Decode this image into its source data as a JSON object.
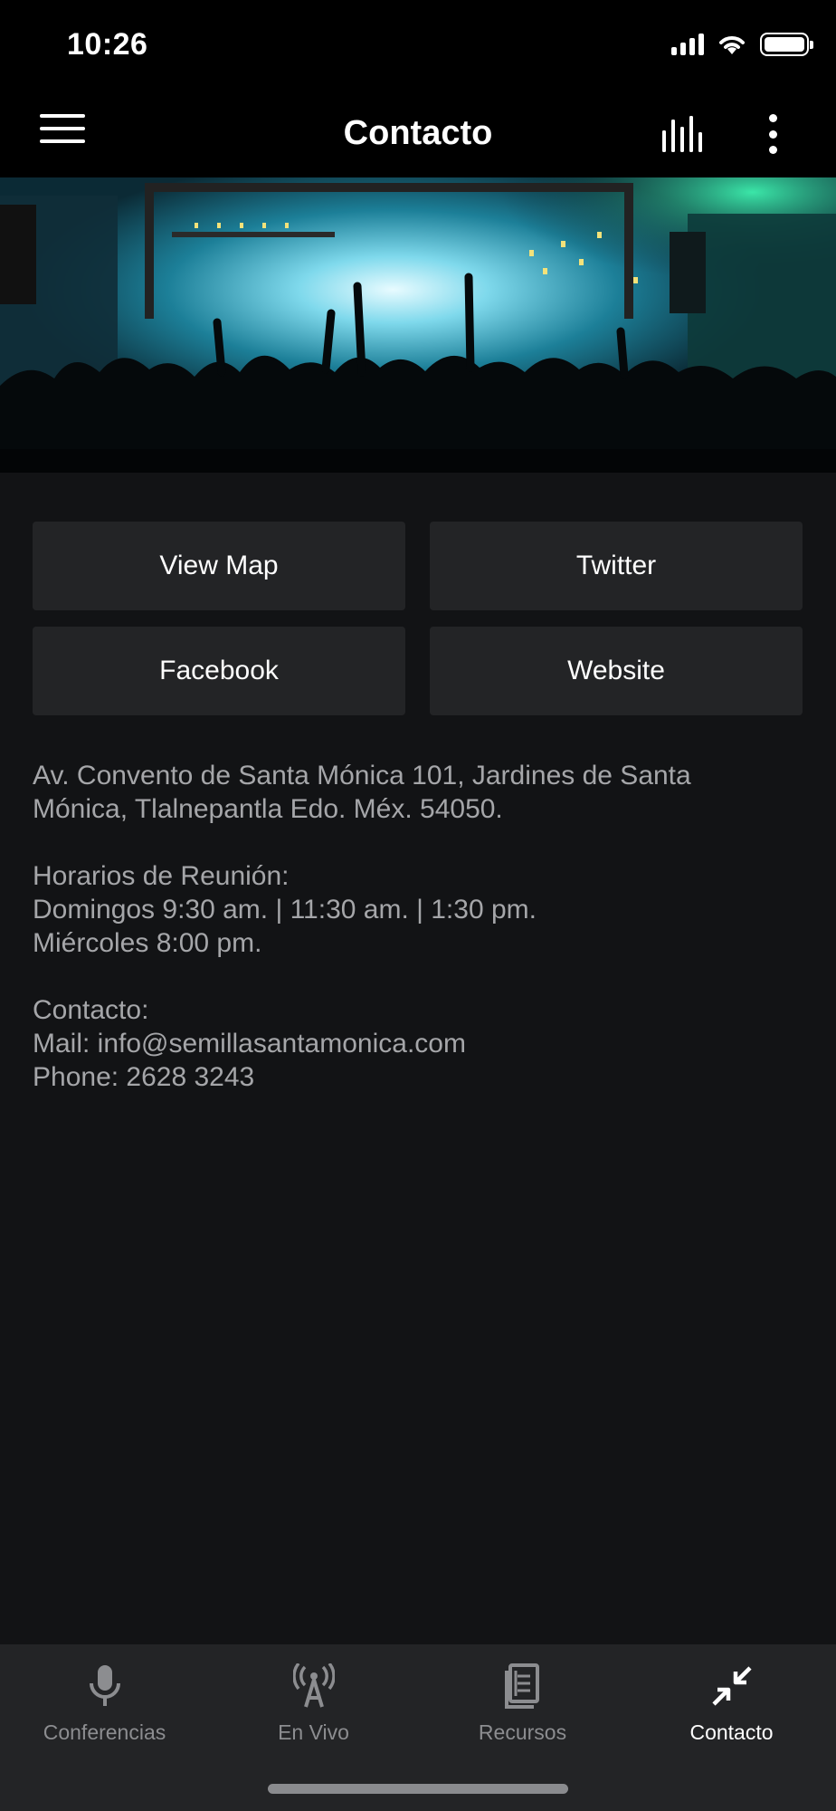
{
  "status_bar": {
    "time": "10:26"
  },
  "app_bar": {
    "title": "Contacto"
  },
  "buttons": {
    "view_map": "View Map",
    "twitter": "Twitter",
    "facebook": "Facebook",
    "website": "Website"
  },
  "info": {
    "address_line1": "Av. Convento de Santa Mónica 101, Jardines de Santa",
    "address_line2": "Mónica, Tlalnepantla Edo. Méx. 54050.",
    "schedule_title": "Horarios de Reunión:",
    "schedule_sunday": "Domingos 9:30 am. | 11:30 am. | 1:30 pm.",
    "schedule_wednesday": "Miércoles 8:00 pm.",
    "contact_title": "Contacto:",
    "mail": "Mail: info@semillasantamonica.com",
    "phone": "Phone: 2628 3243"
  },
  "tabs": [
    {
      "label": "Conferencias",
      "icon": "microphone-icon",
      "active": false
    },
    {
      "label": "En Vivo",
      "icon": "broadcast-icon",
      "active": false
    },
    {
      "label": "Recursos",
      "icon": "document-icon",
      "active": false
    },
    {
      "label": "Contacto",
      "icon": "compress-icon",
      "active": true
    }
  ],
  "colors": {
    "background": "#121315",
    "bar": "#000000",
    "button": "#232426",
    "text_secondary": "#a5a6a9",
    "tab_inactive": "#8c8d90"
  }
}
